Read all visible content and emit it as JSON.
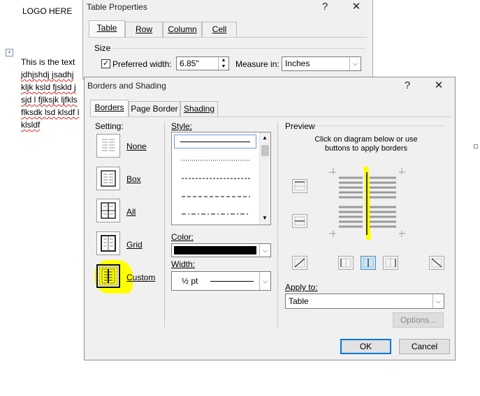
{
  "document": {
    "logo_text": "LOGO HERE",
    "paragraph_lines": [
      "This is  the text ",
      " jdhjshdj jsadhj",
      "kljk ksld fjskld j",
      "sjd l fjlksjk ljfkls",
      "flksdk lsd klsdf l",
      "klsldf"
    ]
  },
  "table_properties": {
    "title": "Table Properties",
    "help_glyph": "?",
    "close_glyph": "✕",
    "tabs": [
      "Table",
      "Row",
      "Column",
      "Cell"
    ],
    "active_tab": "Table",
    "size_group": "Size",
    "preferred_width_label": "Preferred width:",
    "preferred_width_checked": true,
    "preferred_width_value": "6.85\"",
    "measure_in_label": "Measure in:",
    "measure_in_value": "Inches"
  },
  "borders_shading": {
    "title": "Borders and Shading",
    "help_glyph": "?",
    "close_glyph": "✕",
    "tabs": [
      "Borders",
      "Page Border",
      "Shading"
    ],
    "active_tab": "Borders",
    "setting_label": "Setting:",
    "settings": [
      "None",
      "Box",
      "All",
      "Grid",
      "Custom"
    ],
    "selected_setting": "Custom",
    "style_label": "Style:",
    "color_label": "Color:",
    "color_value": "#000000",
    "width_label": "Width:",
    "width_value": "½ pt",
    "preview_label": "Preview",
    "preview_instructions": "Click on diagram below or use buttons to apply borders",
    "apply_to_label": "Apply to:",
    "apply_to_value": "Table",
    "options_button": "Options...",
    "ok_button": "OK",
    "cancel_button": "Cancel",
    "highlight_color": "#ffff00",
    "accent_color": "#0078d7"
  }
}
